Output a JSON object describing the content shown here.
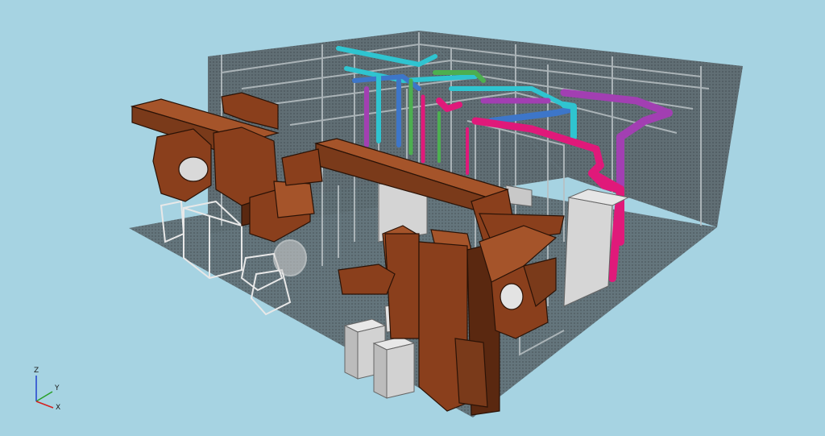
{
  "viewport": {
    "background": "#a6d3e2",
    "scene": "3d-mep-model"
  },
  "colors": {
    "duct": "#8a3f1c",
    "duct_dark": "#5a2810",
    "duct_light": "#a5542a",
    "floor": "#5e6b70",
    "wall": "#59656b",
    "equipment": "#cfcfcf",
    "pipe_magenta": "#e0197a",
    "pipe_purple": "#a23fb2",
    "pipe_cyan": "#2fc4d0",
    "pipe_blue": "#3d76c9",
    "pipe_green": "#4caf50"
  },
  "axes": {
    "z": "Z",
    "y": "Y",
    "x": "X",
    "x_color": "#d62020",
    "y_color": "#28a028",
    "z_color": "#2040d0"
  }
}
